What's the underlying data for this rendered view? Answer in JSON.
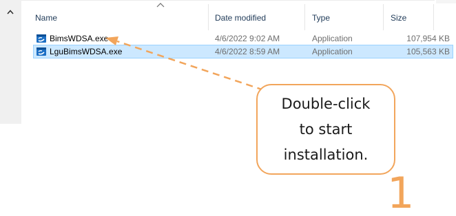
{
  "explorer": {
    "columns": {
      "name": "Name",
      "date_modified": "Date modified",
      "type": "Type",
      "size": "Size"
    },
    "sort_icon": "chevron-up-icon",
    "files": [
      {
        "name": "BimsWDSA.exe",
        "date_modified": "4/6/2022 9:02 AM",
        "type": "Application",
        "size": "107,954 KB",
        "icon": "application-icon",
        "selected": false
      },
      {
        "name": "LguBimsWDSA.exe",
        "date_modified": "4/6/2022 8:59 AM",
        "type": "Application",
        "size": "105,563 KB",
        "icon": "application-icon",
        "selected": true
      }
    ]
  },
  "annotation": {
    "callout_lines": [
      "Double-click",
      "to start",
      "installation."
    ],
    "step_number": "1",
    "accent_color": "#f2a55b"
  },
  "colors": {
    "selection_fill": "#cce8ff",
    "selection_border": "#99d1ff",
    "header_text": "#1e3957"
  }
}
